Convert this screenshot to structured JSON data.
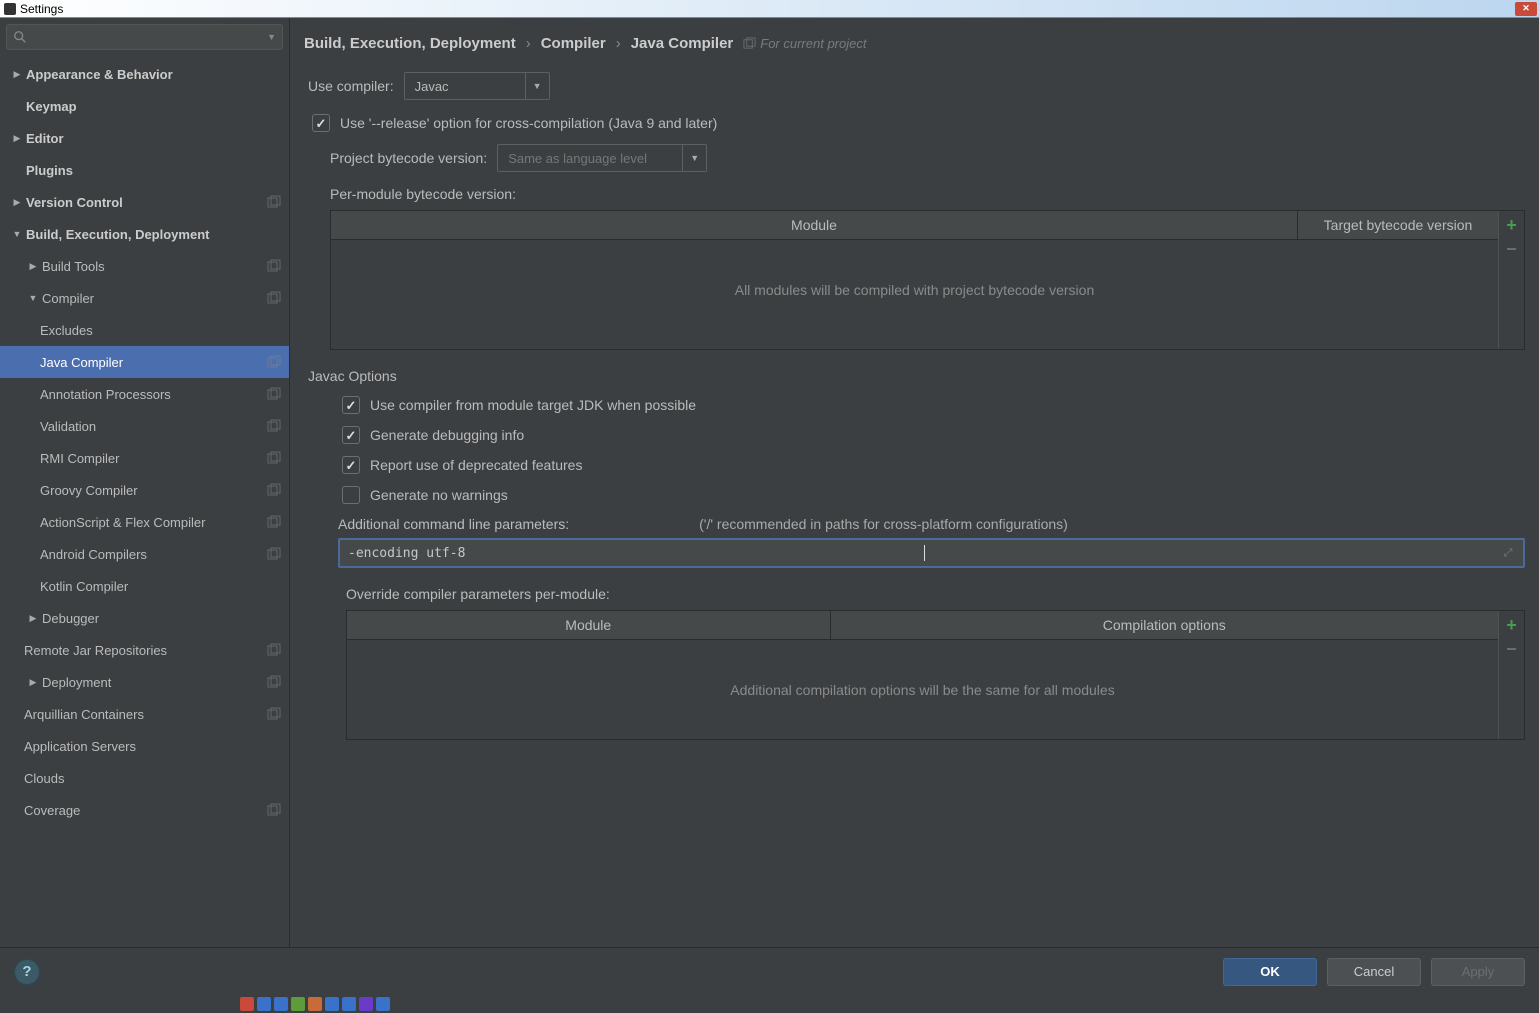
{
  "window": {
    "title": "Settings"
  },
  "search": {
    "placeholder": ""
  },
  "sidebar": {
    "items": [
      {
        "label": "Appearance & Behavior",
        "bold": true,
        "arrow": "right",
        "indent": 0,
        "proj": false
      },
      {
        "label": "Keymap",
        "bold": true,
        "arrow": "",
        "indent": 0,
        "proj": false,
        "pind": true
      },
      {
        "label": "Editor",
        "bold": true,
        "arrow": "right",
        "indent": 0,
        "proj": false
      },
      {
        "label": "Plugins",
        "bold": true,
        "arrow": "",
        "indent": 0,
        "proj": false,
        "pind": true
      },
      {
        "label": "Version Control",
        "bold": true,
        "arrow": "right",
        "indent": 0,
        "proj": true
      },
      {
        "label": "Build, Execution, Deployment",
        "bold": true,
        "arrow": "down",
        "indent": 0,
        "proj": false
      },
      {
        "label": "Build Tools",
        "bold": false,
        "arrow": "right",
        "indent": 1,
        "proj": true
      },
      {
        "label": "Compiler",
        "bold": false,
        "arrow": "down",
        "indent": 1,
        "proj": true
      },
      {
        "label": "Excludes",
        "bold": false,
        "arrow": "",
        "indent": 2,
        "proj": false
      },
      {
        "label": "Java Compiler",
        "bold": false,
        "arrow": "",
        "indent": 2,
        "proj": true,
        "selected": true
      },
      {
        "label": "Annotation Processors",
        "bold": false,
        "arrow": "",
        "indent": 2,
        "proj": true
      },
      {
        "label": "Validation",
        "bold": false,
        "arrow": "",
        "indent": 2,
        "proj": true
      },
      {
        "label": "RMI Compiler",
        "bold": false,
        "arrow": "",
        "indent": 2,
        "proj": true
      },
      {
        "label": "Groovy Compiler",
        "bold": false,
        "arrow": "",
        "indent": 2,
        "proj": true
      },
      {
        "label": "ActionScript & Flex Compiler",
        "bold": false,
        "arrow": "",
        "indent": 2,
        "proj": true
      },
      {
        "label": "Android Compilers",
        "bold": false,
        "arrow": "",
        "indent": 2,
        "proj": true
      },
      {
        "label": "Kotlin Compiler",
        "bold": false,
        "arrow": "",
        "indent": 2,
        "proj": false
      },
      {
        "label": "Debugger",
        "bold": false,
        "arrow": "right",
        "indent": 1,
        "proj": false
      },
      {
        "label": "Remote Jar Repositories",
        "bold": false,
        "arrow": "",
        "indent": 1,
        "proj": true
      },
      {
        "label": "Deployment",
        "bold": false,
        "arrow": "right",
        "indent": 1,
        "proj": true
      },
      {
        "label": "Arquillian Containers",
        "bold": false,
        "arrow": "",
        "indent": 1,
        "proj": true
      },
      {
        "label": "Application Servers",
        "bold": false,
        "arrow": "",
        "indent": 1,
        "proj": false
      },
      {
        "label": "Clouds",
        "bold": false,
        "arrow": "",
        "indent": 1,
        "proj": false
      },
      {
        "label": "Coverage",
        "bold": false,
        "arrow": "",
        "indent": 1,
        "proj": true
      }
    ]
  },
  "breadcrumb": {
    "parts": [
      "Build, Execution, Deployment",
      "Compiler",
      "Java Compiler"
    ],
    "context": "For current project"
  },
  "form": {
    "useCompilerLabel": "Use compiler:",
    "useCompilerValue": "Javac",
    "releaseOption": {
      "checked": true,
      "label": "Use '--release' option for cross-compilation (Java 9 and later)"
    },
    "projectBytecodeLabel": "Project bytecode version:",
    "projectBytecodeValue": "Same as language level",
    "perModuleLabel": "Per-module bytecode version:",
    "table1": {
      "headers": [
        "Module",
        "Target bytecode version"
      ],
      "emptyText": "All modules will be compiled with project bytecode version"
    },
    "javacOptionsTitle": "Javac Options",
    "opt1": {
      "checked": true,
      "label": "Use compiler from module target JDK when possible"
    },
    "opt2": {
      "checked": true,
      "label": "Generate debugging info"
    },
    "opt3": {
      "checked": true,
      "label": "Report use of deprecated features"
    },
    "opt4": {
      "checked": false,
      "label": "Generate no warnings"
    },
    "additionalParamsLabel": "Additional command line parameters:",
    "additionalParamsHint": "('/' recommended in paths for cross-platform configurations)",
    "additionalParamsValue": "-encoding utf-8",
    "overrideLabel": "Override compiler parameters per-module:",
    "table2": {
      "headers": [
        "Module",
        "Compilation options"
      ],
      "emptyText": "Additional compilation options will be the same for all modules"
    }
  },
  "buttons": {
    "ok": "OK",
    "cancel": "Cancel",
    "apply": "Apply"
  }
}
